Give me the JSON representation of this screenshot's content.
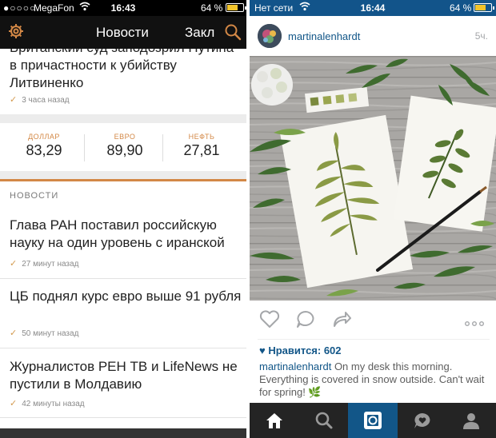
{
  "left": {
    "status": {
      "signal": "●○○○○",
      "carrier": "MegaFon",
      "time": "16:43",
      "battery": "64 %",
      "battery_level": 0.64
    },
    "header": {
      "title": "Новости",
      "tab2": "Закл"
    },
    "top_article": {
      "title": "Британский суд заподозрил Путина в причастности к убийству Литвиненко",
      "meta": "3 часа назад"
    },
    "rates": [
      {
        "label": "ДОЛЛАР",
        "value": "83,29"
      },
      {
        "label": "ЕВРО",
        "value": "89,90"
      },
      {
        "label": "НЕФТЬ",
        "value": "27,81"
      }
    ],
    "section_title": "НОВОСТИ",
    "articles": [
      {
        "title": "Глава РАН поставил российскую науку на один уровень с иранской",
        "meta": "27 минут назад"
      },
      {
        "title": "ЦБ поднял курс евро выше 91 рубля",
        "meta": "50 минут назад"
      },
      {
        "title": "Журналистов РЕН ТВ и LifeNews не пустили в Молдавию",
        "meta": "42 минуты назад"
      }
    ],
    "colors": {
      "accent": "#d38846",
      "header_bg": "#111111"
    }
  },
  "right": {
    "status": {
      "carrier": "Нет сети",
      "time": "16:44",
      "battery": "64 %",
      "battery_level": 0.64
    },
    "post": {
      "username": "martinalenhardt",
      "time_ago": "5ч.",
      "likes": "♥ Нравится: 602",
      "caption_user": "martinalenhardt",
      "caption_text": " On my desk this morning. Everything is covered in snow outside. Can't wait for spring! 🌿"
    },
    "action_icons": [
      "heart-icon",
      "comment-icon",
      "share-icon",
      "more-icon"
    ],
    "tabs": [
      "home-icon",
      "search-icon",
      "camera-icon",
      "activity-icon",
      "profile-icon"
    ],
    "active_tab": 2,
    "colors": {
      "brand": "#125688",
      "tabbar": "#242424"
    }
  }
}
